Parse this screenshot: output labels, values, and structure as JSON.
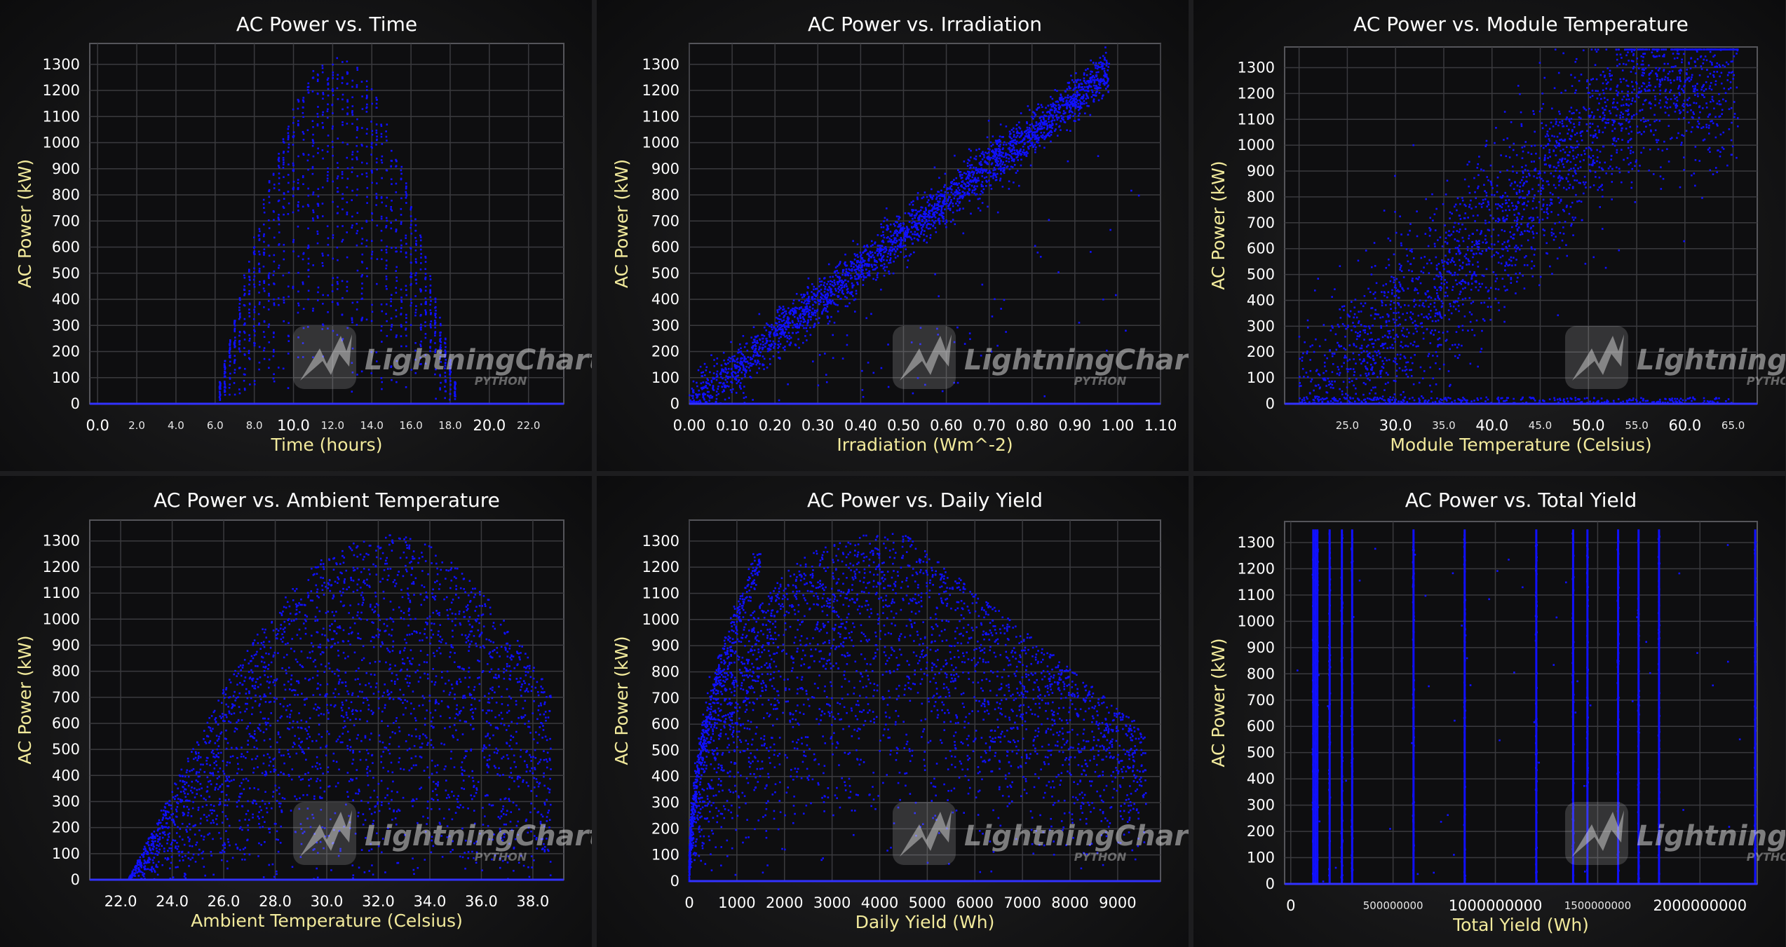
{
  "watermark": {
    "brand": "LightningChart®",
    "sub": "PYTHON"
  },
  "colors": {
    "background": "#1d1d1f",
    "marker": "#1010ff",
    "grid": "#3a3a3e",
    "axis_title": "#f2ea9c",
    "tick": "#ffffff"
  },
  "chart_data": [
    {
      "id": "time",
      "type": "scatter",
      "title": "AC Power vs. Time",
      "xlabel": "Time (hours)",
      "ylabel": "AC Power (kW)",
      "xlim": [
        -0.4,
        23.8
      ],
      "ylim": [
        0,
        1380
      ],
      "x_major_ticks": [
        {
          "v": 0,
          "label": "0.0"
        },
        {
          "v": 10,
          "label": "10.0"
        },
        {
          "v": 20,
          "label": "20.0"
        }
      ],
      "x_minor_ticks": [
        {
          "v": 2,
          "label": "2.0"
        },
        {
          "v": 4,
          "label": "4.0"
        },
        {
          "v": 6,
          "label": "6.0"
        },
        {
          "v": 8,
          "label": "8.0"
        },
        {
          "v": 12,
          "label": "12.0"
        },
        {
          "v": 14,
          "label": "14.0"
        },
        {
          "v": 16,
          "label": "16.0"
        },
        {
          "v": 18,
          "label": "18.0"
        },
        {
          "v": 22,
          "label": "22.0"
        }
      ],
      "y_ticks": [
        0,
        100,
        200,
        300,
        400,
        500,
        600,
        700,
        800,
        900,
        1000,
        1100,
        1200,
        1300
      ],
      "x_grid": [
        0,
        2,
        4,
        6,
        8,
        10,
        12,
        14,
        16,
        18,
        20,
        22
      ],
      "pattern": "time",
      "approx_points": [
        [
          6.0,
          0
        ],
        [
          7.0,
          300
        ],
        [
          8.0,
          650
        ],
        [
          9.0,
          950
        ],
        [
          10.0,
          1150
        ],
        [
          11.0,
          1280
        ],
        [
          12.0,
          1340
        ],
        [
          13.0,
          1300
        ],
        [
          14.0,
          1200
        ],
        [
          15.0,
          950
        ],
        [
          16.0,
          700
        ],
        [
          17.0,
          400
        ],
        [
          18.5,
          0
        ]
      ]
    },
    {
      "id": "irradiation",
      "type": "scatter",
      "title": "AC Power vs. Irradiation",
      "xlabel": "Irradiation (Wm^-2)",
      "ylabel": "AC Power (kW)",
      "xlim": [
        0,
        1.1
      ],
      "ylim": [
        0,
        1380
      ],
      "x_major_ticks": [
        {
          "v": 0,
          "label": "0.00"
        },
        {
          "v": 0.1,
          "label": "0.10"
        },
        {
          "v": 0.2,
          "label": "0.20"
        },
        {
          "v": 0.3,
          "label": "0.30"
        },
        {
          "v": 0.4,
          "label": "0.40"
        },
        {
          "v": 0.5,
          "label": "0.50"
        },
        {
          "v": 0.6,
          "label": "0.60"
        },
        {
          "v": 0.7,
          "label": "0.70"
        },
        {
          "v": 0.8,
          "label": "0.80"
        },
        {
          "v": 0.9,
          "label": "0.90"
        },
        {
          "v": 1.0,
          "label": "1.00"
        },
        {
          "v": 1.1,
          "label": "1.10"
        }
      ],
      "x_minor_ticks": [],
      "y_ticks": [
        0,
        100,
        200,
        300,
        400,
        500,
        600,
        700,
        800,
        900,
        1000,
        1100,
        1200,
        1300
      ],
      "x_grid": [
        0,
        0.1,
        0.2,
        0.3,
        0.4,
        0.5,
        0.6,
        0.7,
        0.8,
        0.9,
        1.0,
        1.1
      ],
      "pattern": "irradiation",
      "approx_points": [
        [
          0.0,
          0
        ],
        [
          0.1,
          150
        ],
        [
          0.2,
          300
        ],
        [
          0.3,
          430
        ],
        [
          0.4,
          560
        ],
        [
          0.5,
          700
        ],
        [
          0.6,
          830
        ],
        [
          0.7,
          950
        ],
        [
          0.8,
          1080
        ],
        [
          0.9,
          1200
        ],
        [
          0.97,
          1280
        ]
      ]
    },
    {
      "id": "module",
      "type": "scatter",
      "title": "AC Power vs. Module Temperature",
      "xlabel": "Module Temperature (Celsius)",
      "ylabel": "AC Power (kW)",
      "xlim": [
        18.5,
        67.5
      ],
      "ylim": [
        0,
        1380
      ],
      "x_major_ticks": [
        {
          "v": 30,
          "label": "30.0"
        },
        {
          "v": 40,
          "label": "40.0"
        },
        {
          "v": 50,
          "label": "50.0"
        },
        {
          "v": 60,
          "label": "60.0"
        }
      ],
      "x_minor_ticks": [
        {
          "v": 25,
          "label": "25.0"
        },
        {
          "v": 35,
          "label": "35.0"
        },
        {
          "v": 45,
          "label": "45.0"
        },
        {
          "v": 55,
          "label": "55.0"
        },
        {
          "v": 65,
          "label": "65.0"
        }
      ],
      "y_ticks": [
        0,
        100,
        200,
        300,
        400,
        500,
        600,
        700,
        800,
        900,
        1000,
        1100,
        1200,
        1300
      ],
      "x_grid": [
        20,
        25,
        30,
        35,
        40,
        45,
        50,
        55,
        60,
        65
      ],
      "pattern": "module",
      "approx_points": [
        [
          20,
          0
        ],
        [
          25,
          100
        ],
        [
          30,
          300
        ],
        [
          35,
          500
        ],
        [
          40,
          700
        ],
        [
          45,
          880
        ],
        [
          50,
          1050
        ],
        [
          55,
          1200
        ],
        [
          60,
          1250
        ],
        [
          65,
          1250
        ]
      ]
    },
    {
      "id": "ambient",
      "type": "scatter",
      "title": "AC Power vs. Ambient Temperature",
      "xlabel": "Ambient Temperature (Celsius)",
      "ylabel": "AC Power (kW)",
      "xlim": [
        20.8,
        39.2
      ],
      "ylim": [
        0,
        1380
      ],
      "x_major_ticks": [
        {
          "v": 22,
          "label": "22.0"
        },
        {
          "v": 24,
          "label": "24.0"
        },
        {
          "v": 26,
          "label": "26.0"
        },
        {
          "v": 28,
          "label": "28.0"
        },
        {
          "v": 30,
          "label": "30.0"
        },
        {
          "v": 32,
          "label": "32.0"
        },
        {
          "v": 34,
          "label": "34.0"
        },
        {
          "v": 36,
          "label": "36.0"
        },
        {
          "v": 38,
          "label": "38.0"
        }
      ],
      "x_minor_ticks": [],
      "y_ticks": [
        0,
        100,
        200,
        300,
        400,
        500,
        600,
        700,
        800,
        900,
        1000,
        1100,
        1200,
        1300
      ],
      "x_grid": [
        22,
        24,
        26,
        28,
        30,
        32,
        34,
        36,
        38
      ],
      "pattern": "ambient",
      "approx_points": [
        [
          22.5,
          0
        ],
        [
          24,
          150
        ],
        [
          26,
          400
        ],
        [
          28,
          700
        ],
        [
          30,
          1000
        ],
        [
          32,
          1250
        ],
        [
          34,
          1300
        ],
        [
          36,
          1200
        ],
        [
          38,
          700
        ]
      ]
    },
    {
      "id": "daily",
      "type": "scatter",
      "title": "AC Power vs. Daily Yield",
      "xlabel": "Daily Yield (Wh)",
      "ylabel": "AC Power (kW)",
      "xlim": [
        0,
        9900
      ],
      "ylim": [
        0,
        1380
      ],
      "x_major_ticks": [
        {
          "v": 0,
          "label": "0"
        },
        {
          "v": 1000,
          "label": "1000"
        },
        {
          "v": 2000,
          "label": "2000"
        },
        {
          "v": 3000,
          "label": "3000"
        },
        {
          "v": 4000,
          "label": "4000"
        },
        {
          "v": 5000,
          "label": "5000"
        },
        {
          "v": 6000,
          "label": "6000"
        },
        {
          "v": 7000,
          "label": "7000"
        },
        {
          "v": 8000,
          "label": "8000"
        },
        {
          "v": 9000,
          "label": "9000"
        }
      ],
      "x_minor_ticks": [],
      "y_ticks": [
        0,
        100,
        200,
        300,
        400,
        500,
        600,
        700,
        800,
        900,
        1000,
        1100,
        1200,
        1300
      ],
      "x_grid": [
        0,
        1000,
        2000,
        3000,
        4000,
        5000,
        6000,
        7000,
        8000,
        9000
      ],
      "pattern": "daily",
      "approx_points": [
        [
          0,
          0
        ],
        [
          200,
          400
        ],
        [
          500,
          700
        ],
        [
          1000,
          950
        ],
        [
          2000,
          1150
        ],
        [
          3000,
          1250
        ],
        [
          4000,
          1300
        ],
        [
          5000,
          1280
        ],
        [
          6000,
          1200
        ],
        [
          7000,
          1050
        ],
        [
          8000,
          850
        ],
        [
          9000,
          500
        ]
      ]
    },
    {
      "id": "total",
      "type": "scatter",
      "title": "AC Power vs. Total Yield",
      "xlabel": "Total Yield (Wh)",
      "ylabel": "AC Power (kW)",
      "xlim": [
        -30000000,
        2280000000
      ],
      "ylim": [
        0,
        1380
      ],
      "x_major_ticks": [
        {
          "v": 0,
          "label": "0"
        },
        {
          "v": 1000000000,
          "label": "1000000000"
        },
        {
          "v": 2000000000,
          "label": "2000000000"
        }
      ],
      "x_minor_ticks": [
        {
          "v": 500000000,
          "label": "500000000"
        },
        {
          "v": 1500000000,
          "label": "1500000000"
        }
      ],
      "y_ticks": [
        0,
        100,
        200,
        300,
        400,
        500,
        600,
        700,
        800,
        900,
        1000,
        1100,
        1200,
        1300
      ],
      "x_grid": [
        0,
        500000000,
        1000000000,
        1500000000,
        2000000000
      ],
      "pattern": "total",
      "vertical_bands": [
        110000000,
        120000000,
        130000000,
        190000000,
        250000000,
        300000000,
        600000000,
        850000000,
        1200000000,
        1380000000,
        1450000000,
        1600000000,
        1700000000,
        1800000000,
        2270000000
      ],
      "approx_points": [
        [
          110000000,
          1300
        ],
        [
          190000000,
          1300
        ],
        [
          250000000,
          1250
        ],
        [
          300000000,
          1000
        ],
        [
          600000000,
          1320
        ],
        [
          850000000,
          1340
        ],
        [
          1200000000,
          1330
        ],
        [
          1380000000,
          1300
        ],
        [
          1450000000,
          1310
        ],
        [
          1600000000,
          1300
        ],
        [
          1700000000,
          1320
        ],
        [
          1800000000,
          1280
        ],
        [
          2270000000,
          1290
        ]
      ]
    }
  ]
}
